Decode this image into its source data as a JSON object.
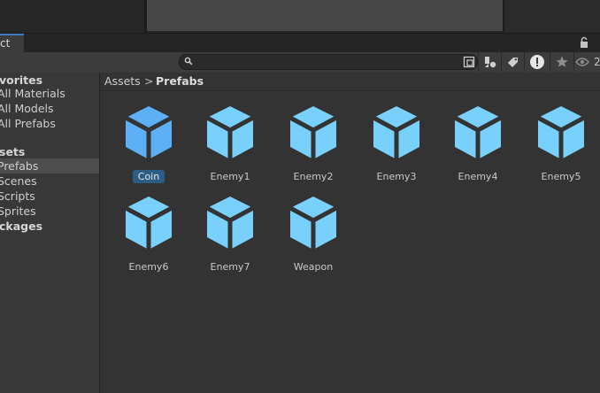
{
  "panel": {
    "tab_label": "ct",
    "eye_count": "2"
  },
  "search": {
    "placeholder": ""
  },
  "sidebar": {
    "items": [
      {
        "label": "vorites",
        "bold": true
      },
      {
        "label": "All Materials",
        "bold": false
      },
      {
        "label": "All Models",
        "bold": false
      },
      {
        "label": "All Prefabs",
        "bold": false
      },
      {
        "label": "sets",
        "bold": true
      },
      {
        "label": "Prefabs",
        "bold": false,
        "selected": true
      },
      {
        "label": "Scenes",
        "bold": false
      },
      {
        "label": "Scripts",
        "bold": false
      },
      {
        "label": "Sprites",
        "bold": false
      },
      {
        "label": "ckages",
        "bold": true
      }
    ]
  },
  "breadcrumb": {
    "root": "Assets",
    "separator": ">",
    "current": "Prefabs"
  },
  "assets": [
    {
      "name": "Coin",
      "selected": true
    },
    {
      "name": "Enemy1"
    },
    {
      "name": "Enemy2"
    },
    {
      "name": "Enemy3"
    },
    {
      "name": "Enemy4"
    },
    {
      "name": "Enemy5"
    },
    {
      "name": "Enemy6"
    },
    {
      "name": "Enemy7"
    },
    {
      "name": "Weapon"
    }
  ],
  "colors": {
    "prefab_icon": "#79d1fb",
    "prefab_icon_selected": "#5db0f5",
    "selection": "#2c5d87"
  },
  "icons": [
    "search-icon",
    "scene-filter-icon",
    "type-filter-icon",
    "label-filter-icon",
    "warning-filter-icon",
    "favorite-icon",
    "visibility-icon",
    "lock-icon",
    "prefab-cube-icon"
  ]
}
